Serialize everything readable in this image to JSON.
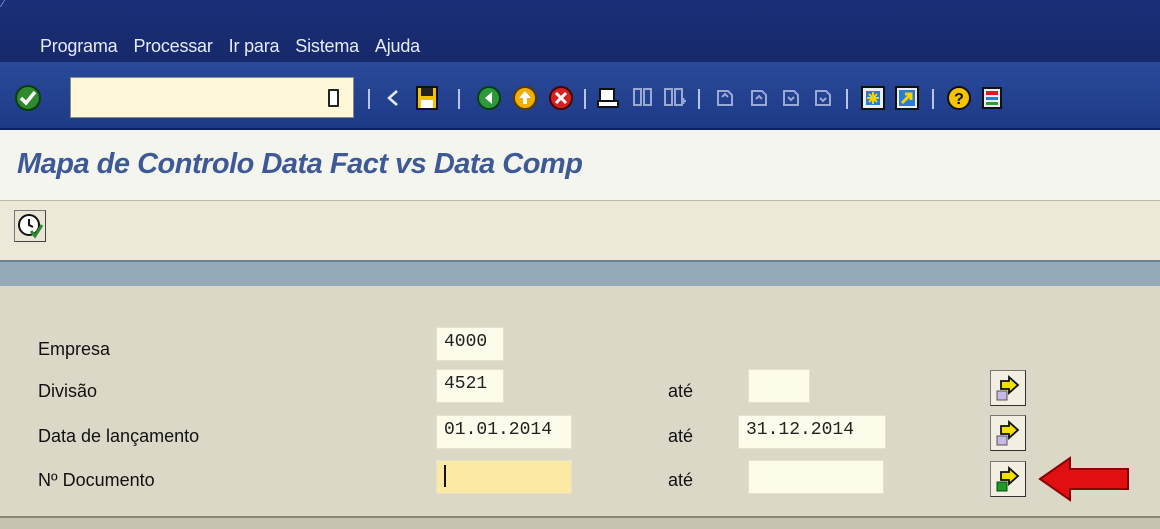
{
  "menu": {
    "items": [
      {
        "label": "Programa"
      },
      {
        "label": "Processar"
      },
      {
        "label": "Ir para"
      },
      {
        "label": "Sistema"
      },
      {
        "label": "Ajuda"
      }
    ]
  },
  "toolbar": {
    "command_field_value": "",
    "icons": [
      "enter-check-icon",
      "back-arrow-icon",
      "save-icon",
      "back-icon",
      "exit-icon",
      "cancel-icon",
      "print-icon",
      "find-icon",
      "find-next-icon",
      "first-page-icon",
      "previous-page-icon",
      "next-page-icon",
      "last-page-icon",
      "new-session-icon",
      "shortcut-icon",
      "help-icon",
      "customize-layout-icon"
    ]
  },
  "page": {
    "title": "Mapa de Controlo Data Fact vs Data Comp"
  },
  "app_toolbar": {
    "execute_icon": "execute-clock-icon"
  },
  "form": {
    "rows": [
      {
        "label": "Empresa",
        "from": "4000",
        "to_label": "",
        "to": ""
      },
      {
        "label": "Divisão",
        "from": "4521",
        "to_label": "até",
        "to": ""
      },
      {
        "label": "Data de lançamento",
        "from": "01.01.2014",
        "to_label": "até",
        "to": "31.12.2014"
      },
      {
        "label": "Nº Documento",
        "from": "",
        "to_label": "até",
        "to": ""
      }
    ]
  },
  "colors": {
    "menubar": "#1a2f78",
    "title_text": "#3e5a96",
    "active_field": "#fbe9a4",
    "annotation_arrow": "#e01010"
  }
}
